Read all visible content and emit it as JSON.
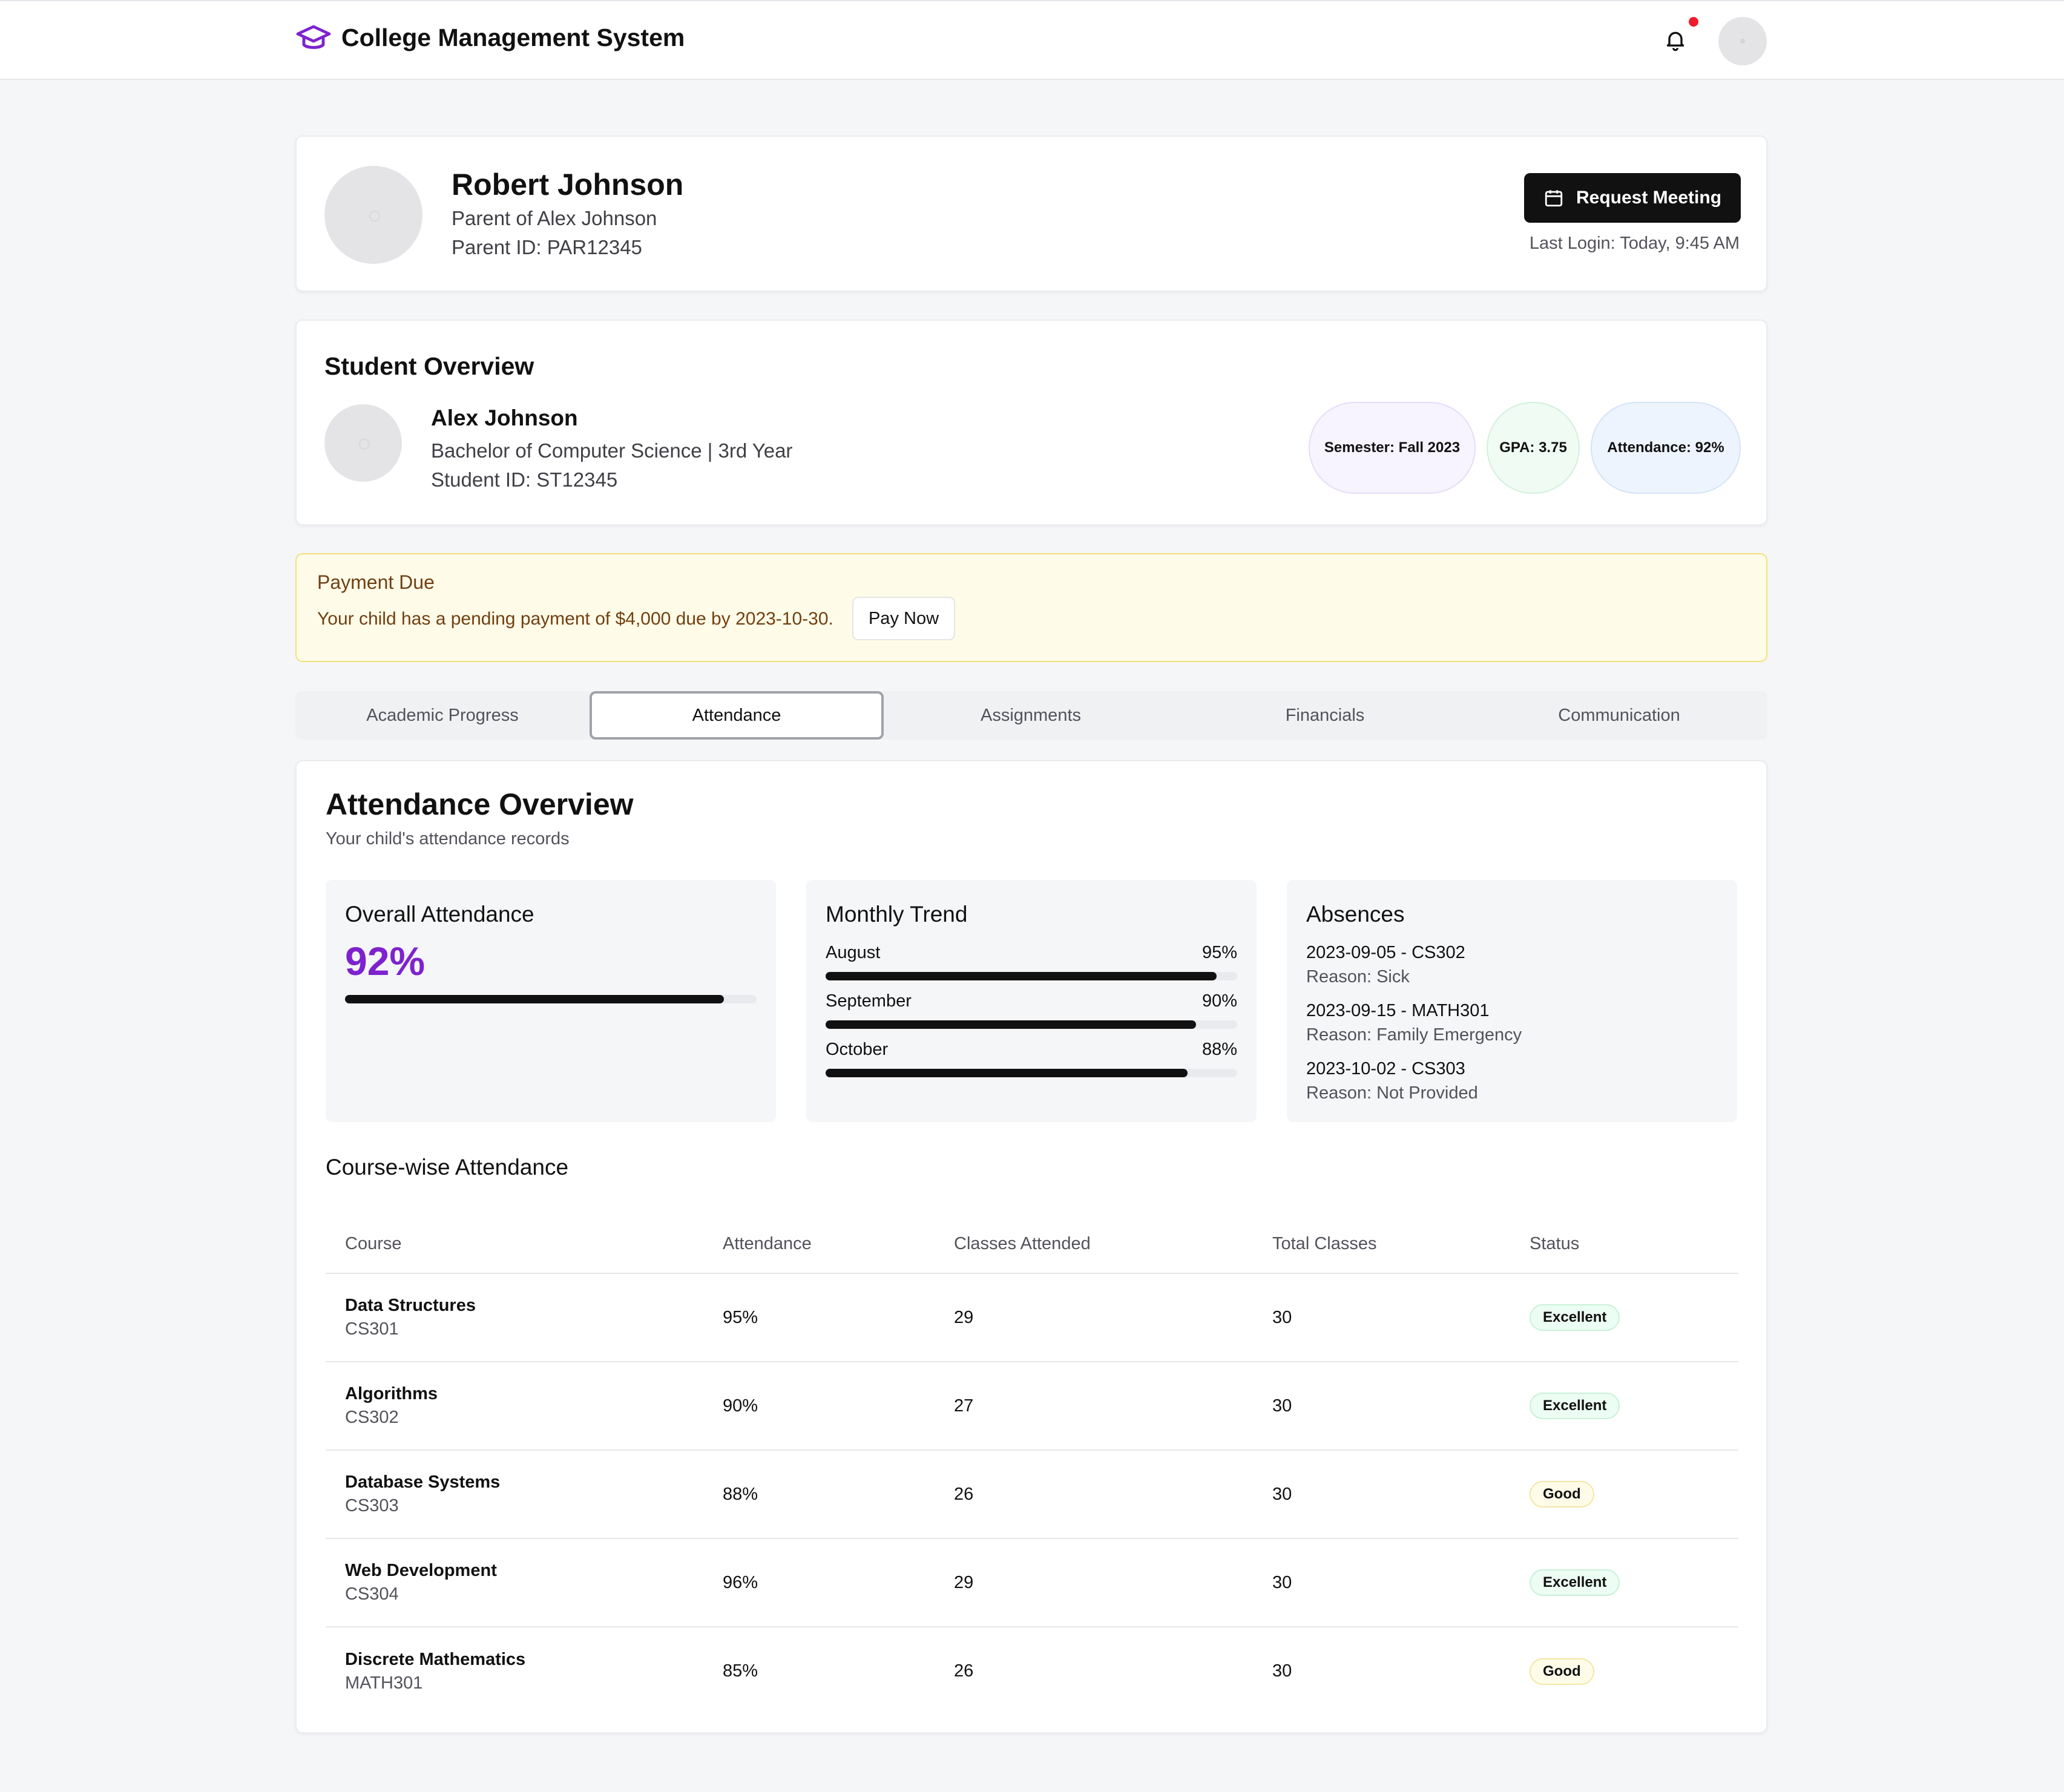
{
  "app": {
    "title": "College Management System",
    "accent": "#7e22ce"
  },
  "icons": {
    "brand": "graduation-cap-icon",
    "notifications": "bell-icon",
    "meeting": "calendar-icon"
  },
  "parent": {
    "name": "Robert Johnson",
    "relation": "Parent of Alex Johnson",
    "id_line": "Parent ID: PAR12345",
    "request_button": "Request Meeting",
    "last_login": "Last Login: Today, 9:45 AM"
  },
  "student": {
    "section_title": "Student Overview",
    "name": "Alex Johnson",
    "program": "Bachelor of Computer Science | 3rd Year",
    "id_line": "Student ID: ST12345",
    "pills": [
      {
        "label": "Semester: Fall 2023",
        "bg": "#f7f3ff",
        "border": "#e7dcf7"
      },
      {
        "label": "GPA: 3.75",
        "bg": "#effbf3",
        "border": "#d3f0dc"
      },
      {
        "label": "Attendance: 92%",
        "bg": "#edf4fe",
        "border": "#d5e3f7"
      }
    ]
  },
  "payment": {
    "title": "Payment Due",
    "message": "Your child has a pending payment of $4,000 due by 2023-10-30.",
    "button": "Pay Now"
  },
  "tabs": [
    {
      "label": "Academic Progress",
      "active": false
    },
    {
      "label": "Attendance",
      "active": true
    },
    {
      "label": "Assignments",
      "active": false
    },
    {
      "label": "Financials",
      "active": false
    },
    {
      "label": "Communication",
      "active": false
    }
  ],
  "attendance": {
    "title": "Attendance Overview",
    "subtitle": "Your child's attendance records",
    "overall": {
      "title": "Overall Attendance",
      "value": "92%",
      "fraction": 0.92
    },
    "trend": {
      "title": "Monthly Trend",
      "months": [
        {
          "label": "August",
          "value": "95%",
          "fraction": 0.95
        },
        {
          "label": "September",
          "value": "90%",
          "fraction": 0.9
        },
        {
          "label": "October",
          "value": "88%",
          "fraction": 0.88
        }
      ]
    },
    "absences": {
      "title": "Absences",
      "items": [
        {
          "head": "2023-09-05 - CS302",
          "reason": "Reason: Sick"
        },
        {
          "head": "2023-09-15 - MATH301",
          "reason": "Reason: Family Emergency"
        },
        {
          "head": "2023-10-02 - CS303",
          "reason": "Reason: Not Provided"
        }
      ]
    }
  },
  "course_table": {
    "title": "Course-wise Attendance",
    "headers": [
      "Course",
      "Attendance",
      "Classes Attended",
      "Total Classes",
      "Status"
    ],
    "rows": [
      {
        "name": "Data Structures",
        "code": "CS301",
        "attendance": "95%",
        "attended": "29",
        "total": "30",
        "status": "Excellent",
        "level": "excellent"
      },
      {
        "name": "Algorithms",
        "code": "CS302",
        "attendance": "90%",
        "attended": "27",
        "total": "30",
        "status": "Excellent",
        "level": "excellent"
      },
      {
        "name": "Database Systems",
        "code": "CS303",
        "attendance": "88%",
        "attended": "26",
        "total": "30",
        "status": "Good",
        "level": "good"
      },
      {
        "name": "Web Development",
        "code": "CS304",
        "attendance": "96%",
        "attended": "29",
        "total": "30",
        "status": "Excellent",
        "level": "excellent"
      },
      {
        "name": "Discrete Mathematics",
        "code": "MATH301",
        "attendance": "85%",
        "attended": "26",
        "total": "30",
        "status": "Good",
        "level": "good"
      }
    ]
  }
}
